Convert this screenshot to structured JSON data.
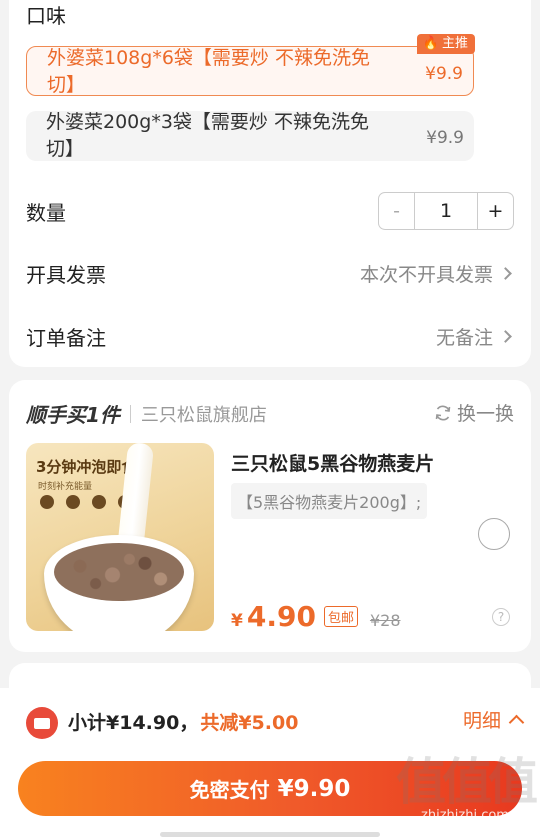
{
  "options_section": {
    "label": "口味",
    "options": [
      {
        "text": "外婆菜108g*6袋【需要炒 不辣免洗免切】",
        "price": "¥9.9",
        "badge": "主推",
        "selected": true
      },
      {
        "text": "外婆菜200g*3袋【需要炒 不辣免洗免切】",
        "price": "¥9.9",
        "selected": false
      }
    ]
  },
  "quantity": {
    "label": "数量",
    "minus": "-",
    "value": "1",
    "plus": "+"
  },
  "invoice": {
    "label": "开具发票",
    "value": "本次不开具发票"
  },
  "remark": {
    "label": "订单备注",
    "value": "无备注"
  },
  "addon": {
    "title": "顺手买1件",
    "shop": "三只松鼠旗舰店",
    "swap_label": "换一换",
    "product": {
      "image_text": "3分钟冲泡即食",
      "image_subtext": "时刻补充能量",
      "name": "三只松鼠5黑谷物燕麦片",
      "spec": "【5黑谷物燕麦片200g】;",
      "currency": "¥",
      "price": "4.90",
      "shipping_tag": "包邮",
      "original_price": "¥28",
      "help": "?"
    }
  },
  "footer": {
    "subtotal": "小计¥14.90，",
    "discount": "共减¥5.00",
    "detail_label": "明细",
    "pay_label": "免密支付",
    "pay_amount": "¥9.90"
  },
  "watermark": {
    "logo": "值值值",
    "url": "zhizhizhi.com"
  },
  "colors": {
    "accent": "#ec6a2a",
    "pay_gradient_start": "#f8821f",
    "pay_gradient_end": "#e8391f",
    "background": "#f3f3f3"
  }
}
